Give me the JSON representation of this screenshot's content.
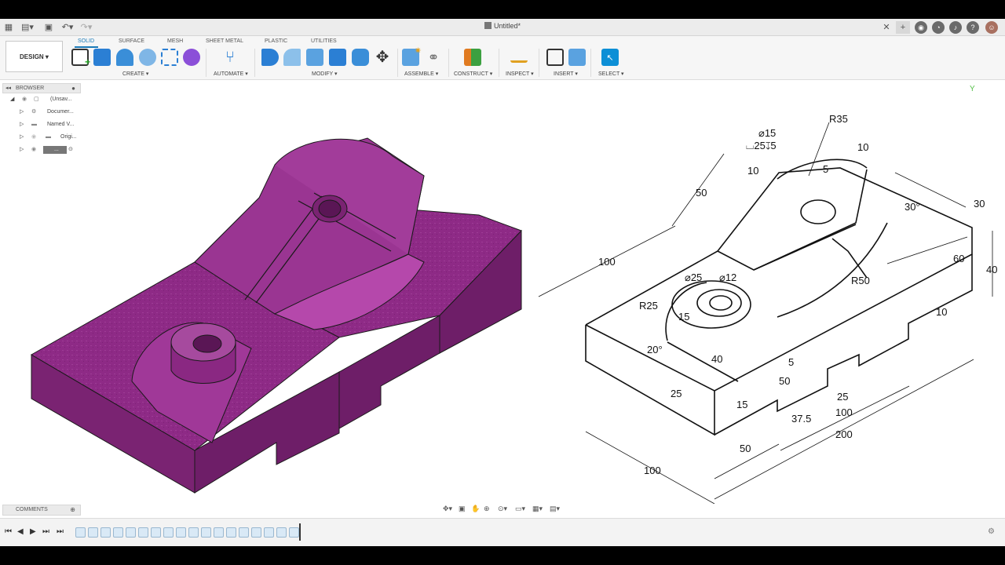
{
  "titlebar": {
    "document_title": "Untitled*",
    "icons": [
      "grid-icon",
      "file-icon",
      "save-icon",
      "undo-icon",
      "redo-icon",
      "close-tab-icon",
      "new-tab-icon",
      "online-icon",
      "job-status-icon",
      "notifications-icon",
      "help-icon",
      "user-avatar"
    ]
  },
  "toolbar": {
    "workspace": "DESIGN",
    "tabs": [
      {
        "label": "SOLID",
        "active": true
      },
      {
        "label": "SURFACE"
      },
      {
        "label": "MESH"
      },
      {
        "label": "SHEET METAL"
      },
      {
        "label": "PLASTIC"
      },
      {
        "label": "UTILITIES"
      }
    ],
    "groups": [
      {
        "label": "CREATE"
      },
      {
        "label": "AUTOMATE"
      },
      {
        "label": "MODIFY"
      },
      {
        "label": "ASSEMBLE"
      },
      {
        "label": "CONSTRUCT"
      },
      {
        "label": "INSPECT"
      },
      {
        "label": "INSERT"
      },
      {
        "label": "SELECT"
      }
    ]
  },
  "browser": {
    "title": "BROWSER",
    "items": [
      {
        "label": "(Unsav..."
      },
      {
        "label": "Documer..."
      },
      {
        "label": "Named V..."
      },
      {
        "label": "Origi..."
      },
      {
        "label": "..."
      }
    ]
  },
  "comments": {
    "title": "COMMENTS"
  },
  "drawing": {
    "dimensions": [
      "R35",
      "⌀15",
      "⌴25↧5",
      "10",
      "5",
      "10",
      "50",
      "30°",
      "30",
      "60",
      "40",
      "100",
      "R50",
      "⌀25",
      "⌀12",
      "R25",
      "15",
      "10",
      "20°",
      "40",
      "5",
      "50",
      "25",
      "25",
      "15",
      "100",
      "37.5",
      "200",
      "50",
      "100"
    ]
  },
  "colors": {
    "model": "#8e2a86",
    "accent": "#1a7ab8",
    "select": "#0d8fd6"
  }
}
